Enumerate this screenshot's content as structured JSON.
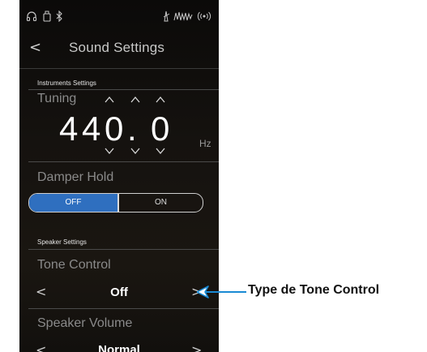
{
  "status_bar": {
    "icons": [
      "headphones-icon",
      "usb-icon",
      "bluetooth-icon",
      "metronome-icon",
      "recorder-icon",
      "wireless-icon"
    ]
  },
  "header": {
    "title": "Sound Settings"
  },
  "instruments": {
    "section_label": "Instruments Settings",
    "tuning": {
      "label": "Tuning",
      "digits": [
        "4",
        "4",
        "0"
      ],
      "decimal": ".",
      "fraction": "0",
      "unit": "Hz"
    },
    "damper_hold": {
      "label": "Damper Hold",
      "off_label": "OFF",
      "on_label": "ON",
      "selected": "OFF"
    }
  },
  "speaker": {
    "section_label": "Speaker Settings",
    "tone_control": {
      "label": "Tone Control",
      "value": "Off"
    },
    "speaker_volume": {
      "label": "Speaker Volume",
      "value": "Normal"
    }
  },
  "annotation": {
    "text": "Type de Tone Control"
  },
  "colors": {
    "accent": "#2f6fbf",
    "annotation_arrow": "#1a8ad4"
  }
}
